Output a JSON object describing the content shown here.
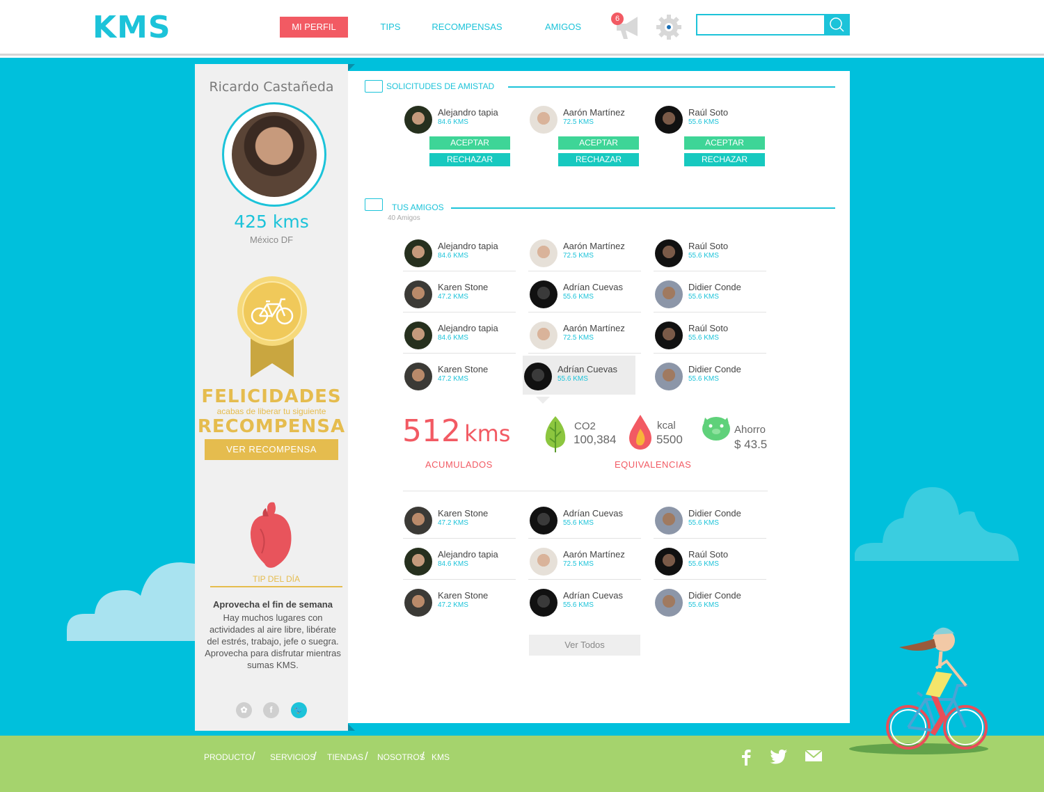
{
  "header": {
    "logo": "KMS",
    "nav": [
      {
        "label": "MI PERFIL",
        "active": true
      },
      {
        "label": "TIPS",
        "active": false
      },
      {
        "label": "RECOMPENSAS",
        "active": false
      },
      {
        "label": "AMIGOS",
        "active": false
      }
    ],
    "notification_count": "6",
    "search": {
      "value": "",
      "placeholder": ""
    }
  },
  "colors": {
    "accent": "#1cc3d9",
    "alert": "#f25a63",
    "gold": "#e5bc4e",
    "accept": "#3ed597",
    "reject": "#17c9bf",
    "grass": "#a5d36d"
  },
  "profile": {
    "name": "Ricardo Castañeda",
    "kms": "425 kms",
    "city": "México DF",
    "reward_title": "FELICIDADES",
    "reward_sub": "acabas de liberar tu siguiente",
    "reward_word": "RECOMPENSA",
    "reward_button": "VER RECOMPENSA",
    "tip_label": "TIP DEL DÍA",
    "tip_title": "Aprovecha el fin de semana",
    "tip_body": "Hay muchos lugares con actividades al aire libre, libérate del estrés, trabajo, jefe o suegra. Aprovecha para disfrutar mientras sumas KMS.",
    "social_icons": [
      "foursquare-icon",
      "facebook-icon",
      "twitter-icon"
    ]
  },
  "requests": {
    "title": "SOLICITUDES DE AMISTAD",
    "accept_label": "ACEPTAR",
    "reject_label": "RECHAZAR",
    "people": [
      {
        "name": "Alejandro tapia",
        "kms": "84.6 KMS"
      },
      {
        "name": "Aarón Martínez",
        "kms": "72.5 KMS"
      },
      {
        "name": "Raúl Soto",
        "kms": "55.6 KMS"
      }
    ]
  },
  "friends": {
    "title": "TUS AMIGOS",
    "count": "40 Amigos",
    "rows_top": [
      [
        {
          "name": "Alejandro tapia",
          "kms": "84.6 KMS"
        },
        {
          "name": "Aarón Martínez",
          "kms": "72.5 KMS"
        },
        {
          "name": "Raúl Soto",
          "kms": "55.6 KMS"
        }
      ],
      [
        {
          "name": "Karen Stone",
          "kms": "47.2 KMS"
        },
        {
          "name": "Adrían Cuevas",
          "kms": "55.6 KMS"
        },
        {
          "name": "Didier Conde",
          "kms": "55.6 KMS"
        }
      ],
      [
        {
          "name": "Alejandro tapia",
          "kms": "84.6 KMS"
        },
        {
          "name": "Aarón Martínez",
          "kms": "72.5 KMS"
        },
        {
          "name": "Raúl Soto",
          "kms": "55.6 KMS"
        }
      ],
      [
        {
          "name": "Karen Stone",
          "kms": "47.2 KMS"
        },
        {
          "name": "Adrían Cuevas",
          "kms": "55.6 KMS"
        },
        {
          "name": "Didier Conde",
          "kms": "55.6 KMS"
        }
      ]
    ],
    "rows_bottom": [
      [
        {
          "name": "Karen Stone",
          "kms": "47.2 KMS"
        },
        {
          "name": "Adrían Cuevas",
          "kms": "55.6 KMS"
        },
        {
          "name": "Didier Conde",
          "kms": "55.6 KMS"
        }
      ],
      [
        {
          "name": "Alejandro tapia",
          "kms": "84.6 KMS"
        },
        {
          "name": "Aarón Martínez",
          "kms": "72.5 KMS"
        },
        {
          "name": "Raúl Soto",
          "kms": "55.6 KMS"
        }
      ],
      [
        {
          "name": "Karen Stone",
          "kms": "47.2 KMS"
        },
        {
          "name": "Adrían Cuevas",
          "kms": "55.6 KMS"
        },
        {
          "name": "Didier Conde",
          "kms": "55.6 KMS"
        }
      ]
    ],
    "see_all": "Ver Todos"
  },
  "stats": {
    "kms_value": "512",
    "kms_unit": "kms",
    "kms_label": "ACUMULADOS",
    "equivalences_label": "EQUIVALENCIAS",
    "co2_label": "CO2",
    "co2_value": "100,384",
    "kcal_label": "kcal",
    "kcal_value": "5500",
    "savings_label": "Ahorro",
    "savings_value": "$ 43.5"
  },
  "footer": {
    "links": [
      "PRODUCTO",
      "SERVICIOS",
      "TIENDAS",
      "NOSOTROS",
      "KMS"
    ],
    "separator": "/",
    "social_icons": [
      "facebook-icon",
      "twitter-icon",
      "mail-icon"
    ]
  }
}
